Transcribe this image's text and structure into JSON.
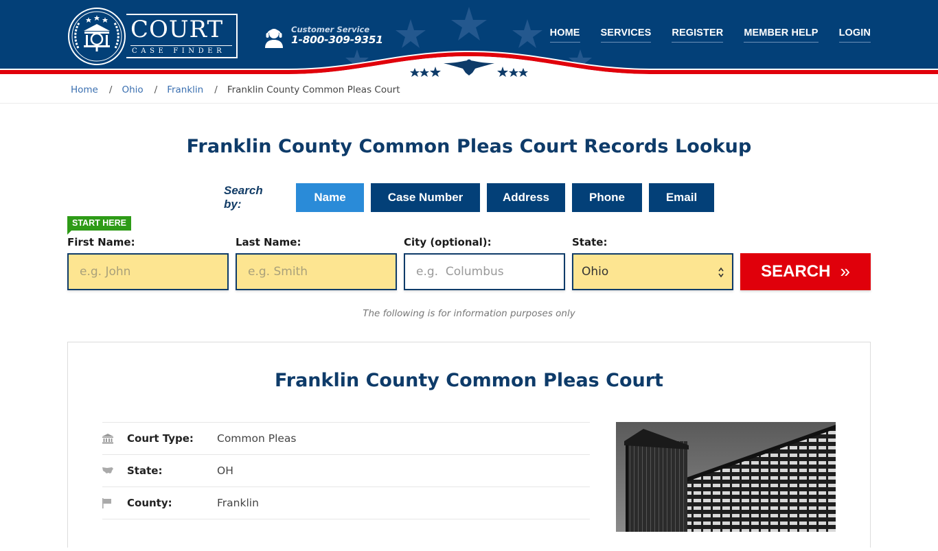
{
  "header": {
    "logo": {
      "title": "COURT",
      "subtitle": "CASE FINDER"
    },
    "customer_service": {
      "label": "Customer Service",
      "phone": "1-800-309-9351",
      "icon": "headset-user-icon"
    },
    "nav": [
      {
        "label": "HOME"
      },
      {
        "label": "SERVICES"
      },
      {
        "label": "REGISTER"
      },
      {
        "label": "MEMBER HELP"
      },
      {
        "label": "LOGIN"
      }
    ],
    "colors": {
      "navy": "#034078",
      "red": "#e0000b"
    }
  },
  "breadcrumb": {
    "items": [
      {
        "label": "Home"
      },
      {
        "label": "Ohio"
      },
      {
        "label": "Franklin"
      }
    ],
    "current": "Franklin County Common Pleas Court",
    "separator": "/"
  },
  "main": {
    "title": "Franklin County Common Pleas Court Records Lookup",
    "search_by": {
      "label": "Search by:",
      "tabs": [
        {
          "label": "Name",
          "active": true
        },
        {
          "label": "Case Number",
          "active": false
        },
        {
          "label": "Address",
          "active": false
        },
        {
          "label": "Phone",
          "active": false
        },
        {
          "label": "Email",
          "active": false
        }
      ]
    },
    "start_badge": "START HERE",
    "form": {
      "first_name": {
        "label": "First Name:",
        "placeholder": "e.g. John",
        "value": ""
      },
      "last_name": {
        "label": "Last Name:",
        "placeholder": "e.g. Smith",
        "value": ""
      },
      "city": {
        "label": "City (optional):",
        "placeholder": "e.g.  Columbus",
        "value": ""
      },
      "state": {
        "label": "State:",
        "selected": "Ohio"
      },
      "search_button": "SEARCH",
      "search_chevron": "»"
    },
    "info_note": "The following is for information purposes only"
  },
  "court": {
    "title": "Franklin County Common Pleas Court",
    "details": [
      {
        "icon": "courthouse-icon",
        "label": "Court Type:",
        "value": "Common Pleas"
      },
      {
        "icon": "us-map-icon",
        "label": "State:",
        "value": "OH"
      },
      {
        "icon": "flag-icon",
        "label": "County:",
        "value": "Franklin"
      }
    ],
    "photo_alt": "Courthouse building photo"
  }
}
